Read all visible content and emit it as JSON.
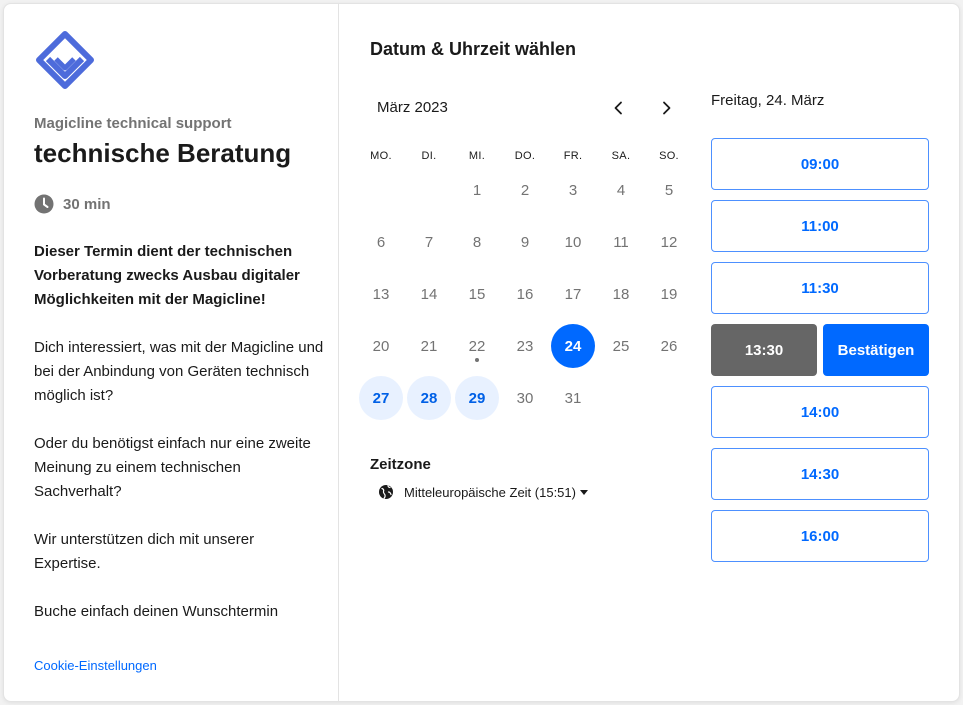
{
  "event": {
    "organizer": "Magicline technical support",
    "title": "technische Beratung",
    "duration": "30 min",
    "description": [
      "Dieser Termin dient der technischen Vorberatung zwecks Ausbau digitaler Möglichkeiten mit der Magicline!",
      "Dich interessiert, was mit der Magicline und bei der Anbindung von Geräten technisch möglich ist?",
      "Oder du benötigst einfach nur eine zweite Meinung zu einem technischen Sachverhalt?",
      "Wir unterstützen dich mit unserer Expertise.",
      "Buche einfach deinen Wunschtermin"
    ],
    "cookie_link": "Cookie-Einstellungen"
  },
  "calendar": {
    "heading": "Datum & Uhrzeit wählen",
    "month": "März 2023",
    "weekdays": [
      "MO.",
      "DI.",
      "MI.",
      "DO.",
      "FR.",
      "SA.",
      "SO."
    ],
    "weeks": [
      [
        "",
        "",
        "1",
        "2",
        "3",
        "4",
        "5"
      ],
      [
        "6",
        "7",
        "8",
        "9",
        "10",
        "11",
        "12"
      ],
      [
        "13",
        "14",
        "15",
        "16",
        "17",
        "18",
        "19"
      ],
      [
        "20",
        "21",
        "22",
        "23",
        "24",
        "25",
        "26"
      ],
      [
        "27",
        "28",
        "29",
        "30",
        "31",
        "",
        ""
      ]
    ],
    "selected_day": "24",
    "today_day": "22",
    "available_days": [
      "24",
      "27",
      "28",
      "29"
    ]
  },
  "timezone": {
    "label": "Zeitzone",
    "value": "Mitteleuropäische Zeit (15:51)"
  },
  "slots": {
    "date_label": "Freitag, 24. März",
    "times": [
      "09:00",
      "11:00",
      "11:30",
      "13:30",
      "14:00",
      "14:30",
      "16:00"
    ],
    "selected_time": "13:30",
    "confirm_label": "Bestätigen"
  },
  "colors": {
    "accent": "#0069ff",
    "logo": "#4d6bdb",
    "selected_slot": "#666666"
  }
}
